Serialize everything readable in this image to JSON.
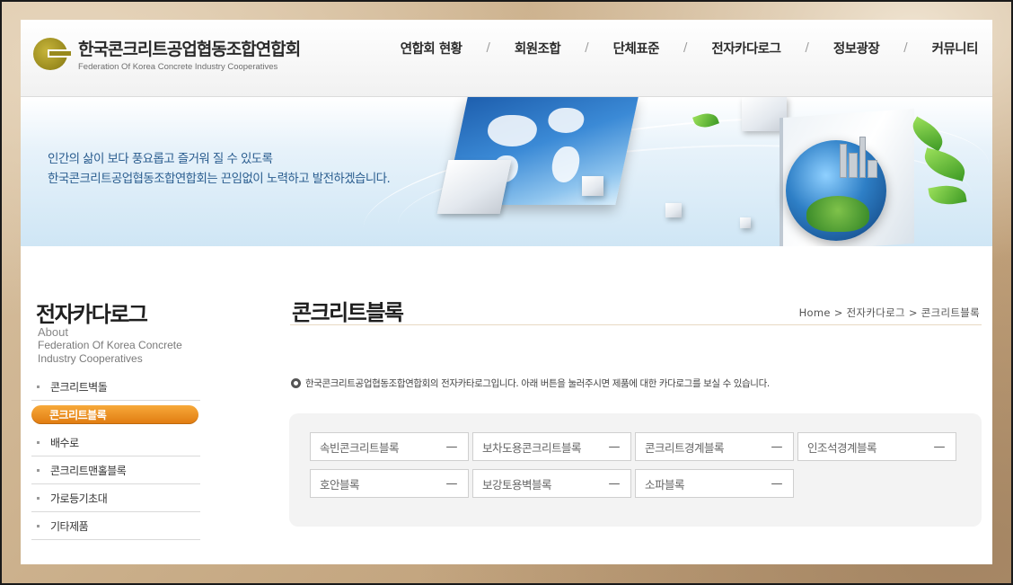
{
  "site": {
    "name_ko": "한국콘크리트공업협동조합연합회",
    "name_en": "Federation Of Korea Concrete Industry Cooperatives"
  },
  "nav": [
    {
      "label": "연합회 현황"
    },
    {
      "label": "회원조합"
    },
    {
      "label": "단체표준"
    },
    {
      "label": "전자카다로그"
    },
    {
      "label": "정보광장"
    },
    {
      "label": "커뮤니티"
    }
  ],
  "nav_separator": "/",
  "banner": {
    "line1": "인간의 삶이 보다 풍요롭고 즐거워 질 수 있도록",
    "line2": "한국콘크리트공업협동조합연합회는 끈임없이 노력하고 발전하겠습니다."
  },
  "sidebar": {
    "title": "전자카다로그",
    "about": "About",
    "sub1": "Federation Of Korea Concrete",
    "sub2": "Industry Cooperatives",
    "items": [
      {
        "label": "콘크리트벽돌",
        "active": false
      },
      {
        "label": "콘크리트블록",
        "active": true
      },
      {
        "label": "배수로",
        "active": false
      },
      {
        "label": "콘크리트맨홀블록",
        "active": false
      },
      {
        "label": "가로등기초대",
        "active": false
      },
      {
        "label": "기타제품",
        "active": false
      }
    ]
  },
  "main": {
    "title": "콘크리트블록",
    "breadcrumb": "Home > 전자카다로그 > 콘크리트블록",
    "notice": "한국콘크리트공업협동조합연합회의 전자카타로그입니다. 아래 버튼을 눌러주시면 제품에 대한 카다로그를 보실 수 있습니다.",
    "catalog_buttons": [
      {
        "label": "속빈콘크리트블록",
        "toggle": "—"
      },
      {
        "label": "보차도용콘크리트블록",
        "toggle": "—"
      },
      {
        "label": "콘크리트경계블록",
        "toggle": "—"
      },
      {
        "label": "인조석경계블록",
        "toggle": "—"
      },
      {
        "label": "호안블록",
        "toggle": "—"
      },
      {
        "label": "보강토용벽블록",
        "toggle": "—"
      },
      {
        "label": "소파블록",
        "toggle": "—"
      }
    ]
  },
  "colors": {
    "accent_orange": "#e88a1a",
    "banner_text": "#2a5d8f",
    "logo_olive": "#98891d"
  }
}
